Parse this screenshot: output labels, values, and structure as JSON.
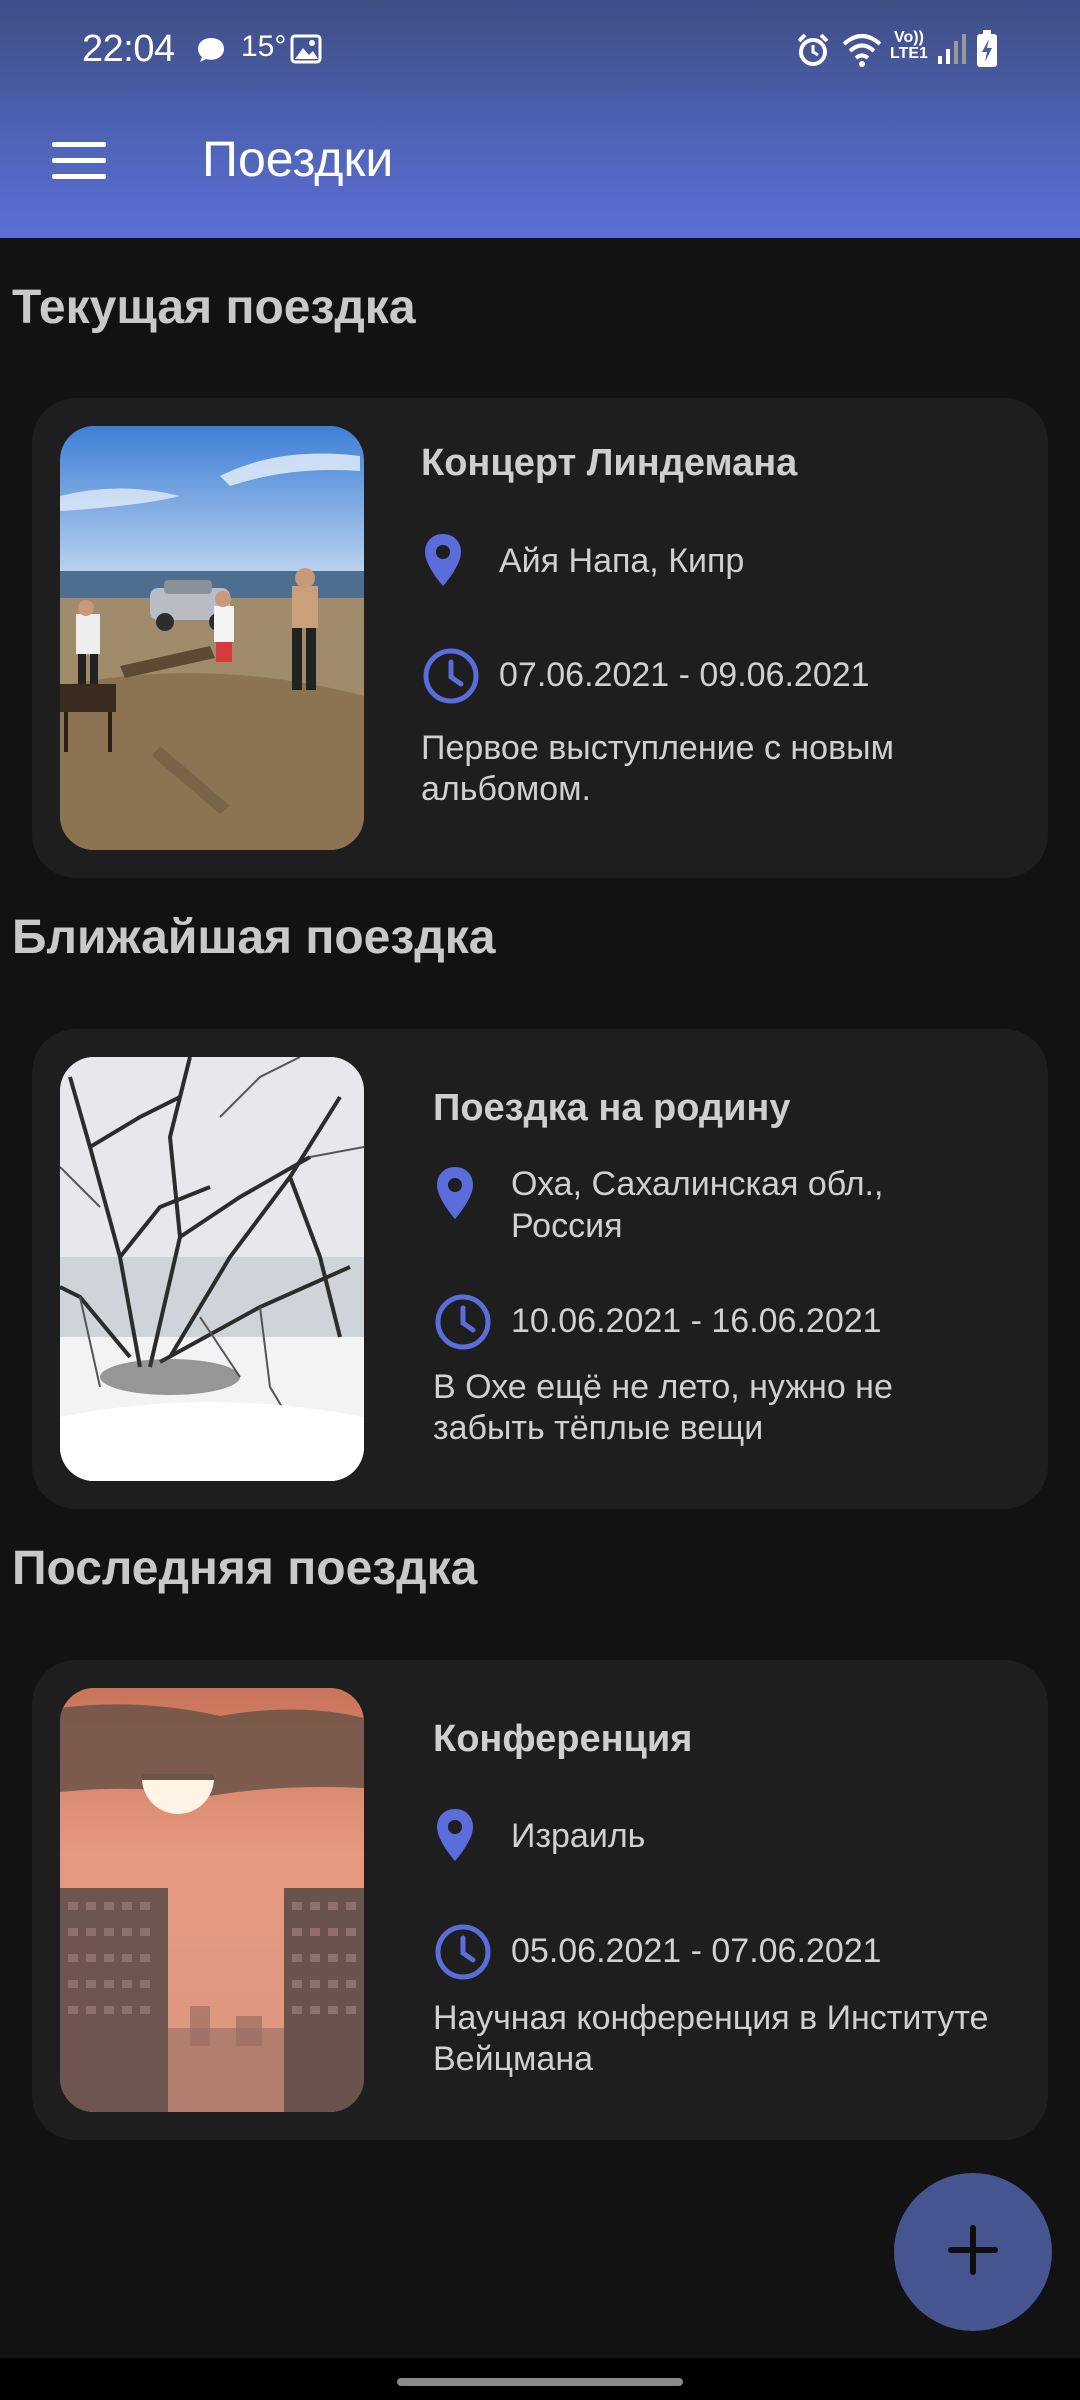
{
  "status_bar": {
    "time": "22:04",
    "temperature": "15°",
    "icons": [
      "message-icon",
      "image-icon",
      "alarm-icon",
      "wifi-icon",
      "volte-icon",
      "signal-icon",
      "battery-charging-icon"
    ],
    "volte_label": "Vo))",
    "lte_label": "LTE1"
  },
  "app_bar": {
    "title": "Поездки",
    "menu_icon": "hamburger-menu-icon"
  },
  "sections": [
    {
      "heading": "Текущая поездка",
      "trip": {
        "title": "Концерт Линдемана",
        "location": "Айя Напа, Кипр",
        "dates": "07.06.2021 - 09.06.2021",
        "description": "Первое выступление с новым альбомом.",
        "photo": "beach-photo"
      }
    },
    {
      "heading": "Ближайшая поездка",
      "trip": {
        "title": "Поездка на родину",
        "location": "Оха, Сахалинская обл., Россия",
        "dates": "10.06.2021 - 16.06.2021",
        "description": "В Охе ещё не лето, нужно не забыть тёплые вещи",
        "photo": "snow-photo"
      }
    },
    {
      "heading": "Последняя поездка",
      "trip": {
        "title": "Конференция",
        "location": "Израиль",
        "dates": "05.06.2021 - 07.06.2021",
        "description": "Научная конференция в Институте Вейцмана",
        "photo": "sunset-photo"
      }
    }
  ],
  "fab": {
    "icon": "plus-icon"
  },
  "colors": {
    "accent": "#5b6ddb",
    "app_bar": "#5a70d6",
    "background": "#121212",
    "card": "#1e1e1e",
    "fab": "#46548f"
  }
}
